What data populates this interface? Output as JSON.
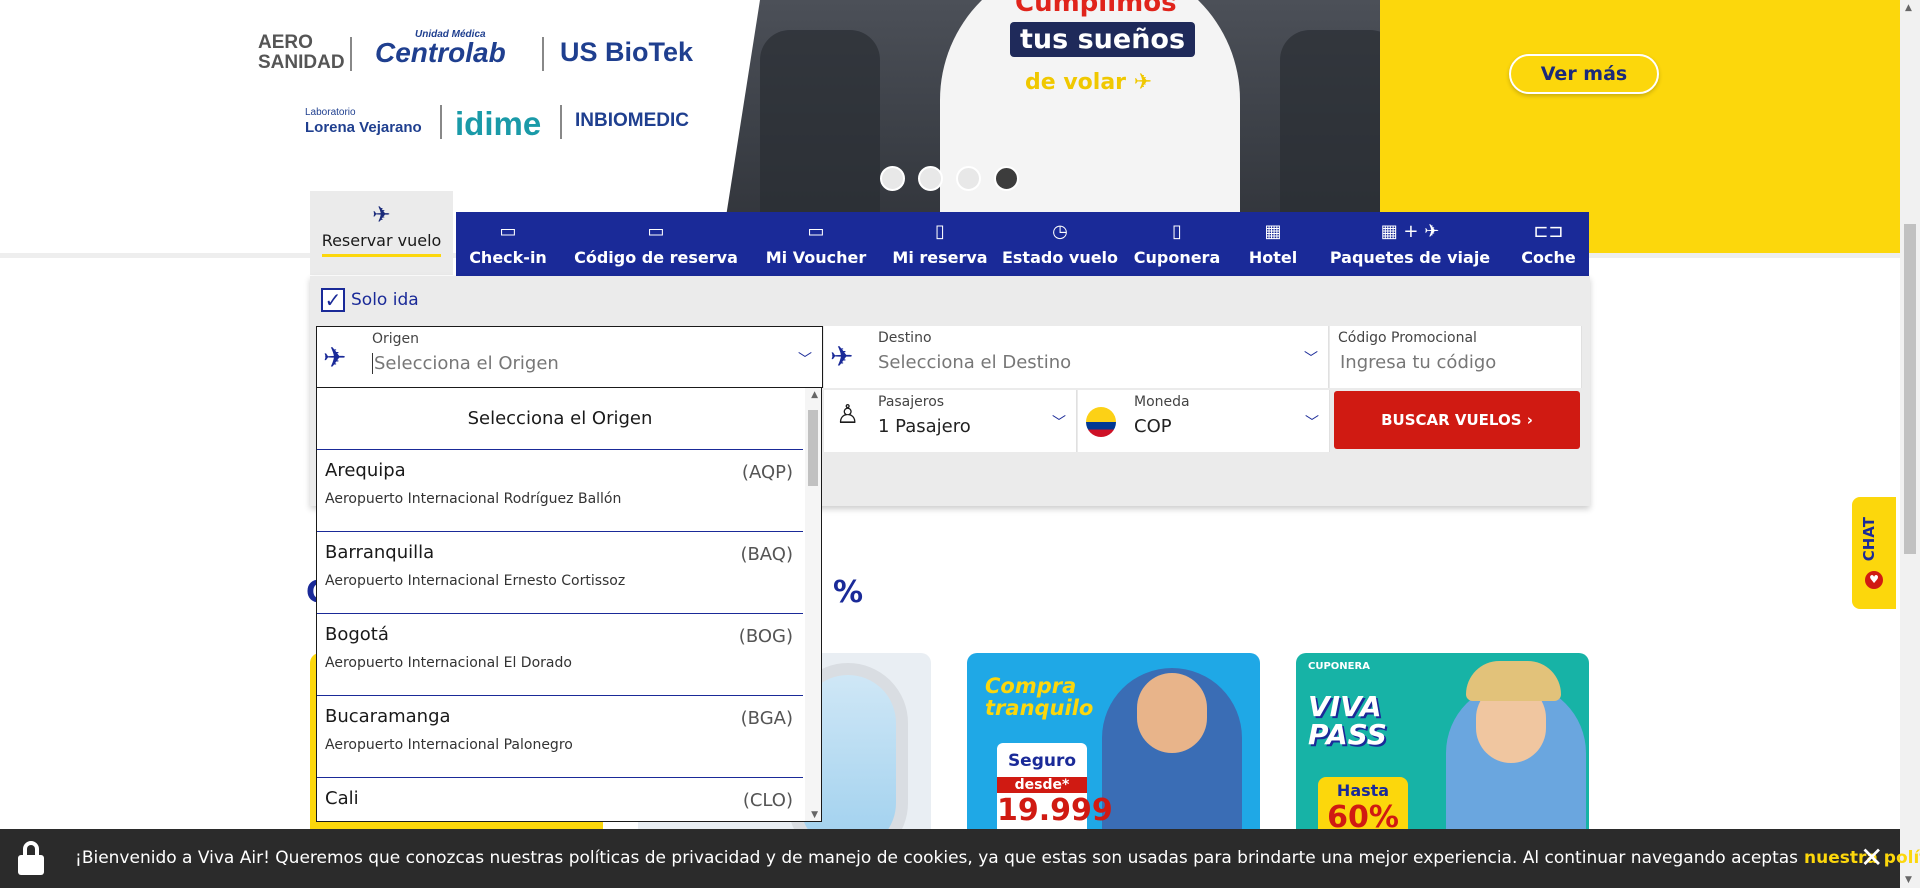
{
  "hero": {
    "line1": "Cumplimos",
    "line2": "tus sueños",
    "line3": "de volar",
    "cta": "Ver más",
    "slides": 4,
    "active_slide": 4,
    "partners": {
      "aero": "AERO SANIDAD",
      "centrolab_small": "Unidad Médica",
      "centrolab": "Centrolab",
      "biotek": "US BioTek",
      "lorena_small": "Laboratorio",
      "lorena": "Lorena Vejarano",
      "idime": "idime",
      "inbiomedic": "INBIOMEDIC"
    }
  },
  "tabs": {
    "active": {
      "icon": "plane-icon",
      "label": "Reservar vuelo"
    },
    "items": [
      {
        "icon": "ticket-icon",
        "label": "Check-in"
      },
      {
        "icon": "boarding-pass-icon",
        "label": "Código de reserva"
      },
      {
        "icon": "voucher-icon",
        "label": "Mi Voucher"
      },
      {
        "icon": "phone-icon",
        "label": "Mi reserva"
      },
      {
        "icon": "clock-icon",
        "label": "Estado vuelo"
      },
      {
        "icon": "phone-coupon-icon",
        "label": "Cuponera"
      },
      {
        "icon": "building-icon",
        "label": "Hotel"
      },
      {
        "icon": "package-icon",
        "label": "Paquetes de viaje"
      },
      {
        "icon": "car-icon",
        "label": "Coche"
      }
    ]
  },
  "form": {
    "solo_ida": {
      "label": "Solo ida",
      "checked": true
    },
    "origen": {
      "label": "Origen",
      "placeholder": "Selecciona el Origen"
    },
    "destino": {
      "label": "Destino",
      "placeholder": "Selecciona el Destino"
    },
    "promo": {
      "label": "Código Promocional",
      "placeholder": "Ingresa tu código"
    },
    "pasajeros": {
      "label": "Pasajeros",
      "value": "1 Pasajero"
    },
    "moneda": {
      "label": "Moneda",
      "value": "COP"
    },
    "buscar": "BUSCAR VUELOS"
  },
  "dropdown": {
    "title": "Selecciona el Origen",
    "items": [
      {
        "city": "Arequipa",
        "code": "(AQP)",
        "airport": "Aeropuerto Internacional Rodríguez Ballón"
      },
      {
        "city": "Barranquilla",
        "code": "(BAQ)",
        "airport": "Aeropuerto Internacional Ernesto Cortissoz"
      },
      {
        "city": "Bogotá",
        "code": "(BOG)",
        "airport": "Aeropuerto Internacional El Dorado"
      },
      {
        "city": "Bucaramanga",
        "code": "(BGA)",
        "airport": "Aeropuerto Internacional Palonegro"
      },
      {
        "city": "Cali",
        "code": "(CLO)",
        "airport": ""
      }
    ]
  },
  "section": {
    "peek_left": "C",
    "peek_right": "%"
  },
  "cards": {
    "c3_title": "Compra tranquilo",
    "c3_seguro": "Seguro",
    "c3_desde": "desde*",
    "c3_price": "19.999",
    "c4_small": "CUPONERA",
    "c4_logo": "VIVA PASS",
    "c4_hasta": "Hasta",
    "c4_pct": "60%"
  },
  "chat": {
    "label": "CHAT"
  },
  "cookie": {
    "text": "¡Bienvenido a Viva Air! Queremos que conozcas nuestras políticas de privacidad y de manejo de cookies, ya que estas son usadas para brindarte una mejor experiencia. Al continuar navegando aceptas",
    "link": "nuestra política."
  }
}
